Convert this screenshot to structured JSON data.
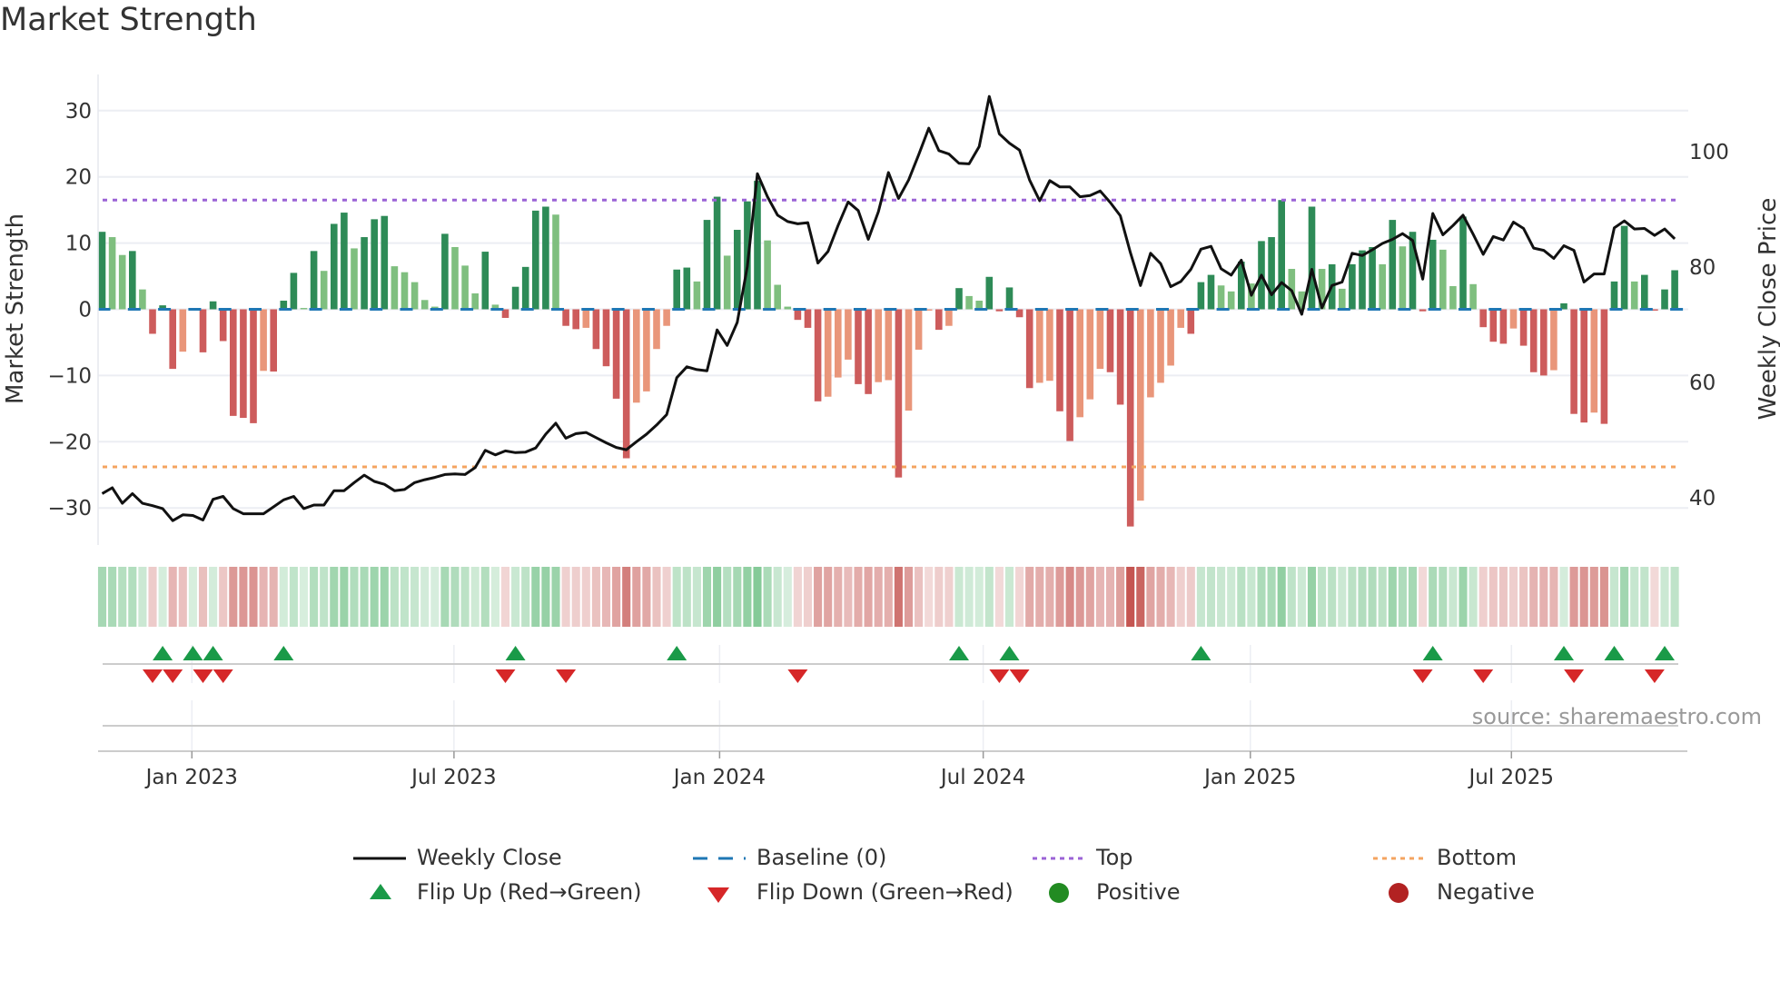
{
  "title": "Market Strength",
  "source": "source: sharemaestro.com",
  "legend": {
    "weekly_close": "Weekly Close",
    "baseline": "Baseline (0)",
    "top": "Top",
    "bottom": "Bottom",
    "flip_up": "Flip Up (Red→Green)",
    "flip_down": "Flip Down (Green→Red)",
    "positive": "Positive",
    "negative": "Negative"
  },
  "colors": {
    "bar_pos_rising": "#2e8b57",
    "bar_pos_falling": "#7fbf7f",
    "bar_neg_falling": "#cd5c5c",
    "bar_neg_rising": "#e9967a",
    "line": "#111111",
    "baseline": "#1f77b4",
    "top": "#9b63d6",
    "bottom": "#f4a460",
    "flip_up": "#1a9a48",
    "flip_down": "#d62728",
    "positive": "#228b22",
    "negative": "#b22222"
  },
  "chart_data": {
    "type": "bar+line",
    "title": "Market Strength",
    "ylabel": "Market Strength",
    "y2label": "Weekly Close Price",
    "ylim": [
      -35,
      35
    ],
    "y2lim": [
      34,
      113
    ],
    "yticks": [
      "30",
      "20",
      "10",
      "0",
      "−10",
      "−20",
      "−30"
    ],
    "ytick_values": [
      30,
      20,
      10,
      0,
      -10,
      -20,
      -30
    ],
    "y2ticks": [
      "100",
      "80",
      "60",
      "40"
    ],
    "y2tick_values": [
      100,
      80,
      60,
      40
    ],
    "top_level": 16.5,
    "bottom_level": -23.8,
    "xticks": [
      {
        "label": "Jan 2023",
        "week": 9.9
      },
      {
        "label": "Jul 2023",
        "week": 35.9
      },
      {
        "label": "Jan 2024",
        "week": 62.25
      },
      {
        "label": "Jul 2024",
        "week": 88.4
      },
      {
        "label": "Jan 2025",
        "week": 114.9
      },
      {
        "label": "Jul 2025",
        "week": 140.8
      }
    ],
    "strength": [
      11.7,
      10.9,
      8.2,
      8.8,
      3.0,
      -3.7,
      0.6,
      -9.0,
      -6.4,
      0.2,
      -6.5,
      1.2,
      -4.8,
      -16.1,
      -16.4,
      -17.2,
      -9.3,
      -9.4,
      1.3,
      5.5,
      0.2,
      8.8,
      5.8,
      12.9,
      14.6,
      9.2,
      10.9,
      13.6,
      14.1,
      6.5,
      5.6,
      4.1,
      1.4,
      0.4,
      11.4,
      9.4,
      6.6,
      2.4,
      8.7,
      0.7,
      -1.3,
      3.4,
      6.4,
      14.9,
      15.5,
      14.3,
      -2.5,
      -3.0,
      -2.8,
      -6.0,
      -8.6,
      -13.5,
      -22.5,
      -14.1,
      -12.4,
      -6.0,
      -2.5,
      6.0,
      6.3,
      4.2,
      13.5,
      17.0,
      8.1,
      12.0,
      16.3,
      19.4,
      10.4,
      3.7,
      0.4,
      -1.6,
      -2.8,
      -13.9,
      -13.2,
      -10.3,
      -7.6,
      -11.3,
      -12.8,
      -11.0,
      -10.7,
      -25.4,
      -15.3,
      -6.1,
      -0.2,
      -3.1,
      -2.5,
      3.2,
      2.0,
      1.3,
      4.9,
      -0.3,
      3.3,
      -1.2,
      -11.9,
      -11.1,
      -10.8,
      -15.4,
      -19.9,
      -16.3,
      -13.6,
      -9.0,
      -9.5,
      -14.4,
      -32.8,
      -28.9,
      -13.3,
      -11.1,
      -8.5,
      -2.8,
      -3.7,
      4.1,
      5.2,
      3.6,
      2.7,
      7.2,
      3.9,
      10.3,
      10.9,
      16.5,
      6.1,
      2.7,
      15.5,
      6.1,
      6.8,
      3.1,
      6.8,
      8.9,
      9.4,
      6.8,
      13.5,
      9.5,
      11.7,
      -0.3,
      10.5,
      9.0,
      3.5,
      14.0,
      3.8,
      -2.7,
      -4.9,
      -5.2,
      -2.9,
      -5.5,
      -9.5,
      -10.0,
      -9.2,
      0.9,
      -15.8,
      -17.1,
      -15.6,
      -17.3,
      4.2,
      12.6,
      4.2,
      5.2,
      -0.2,
      3.0,
      5.9
    ],
    "weekly_close": [
      40.7,
      41.7,
      39.0,
      40.7,
      39.0,
      38.6,
      38.1,
      36.0,
      37.0,
      36.9,
      36.1,
      39.7,
      40.2,
      38.1,
      37.2,
      37.2,
      37.2,
      38.4,
      39.6,
      40.2,
      38.1,
      38.7,
      38.7,
      41.2,
      41.2,
      42.6,
      43.9,
      42.8,
      42.3,
      41.2,
      41.4,
      42.6,
      43.1,
      43.5,
      44.0,
      44.1,
      44.0,
      45.2,
      48.2,
      47.4,
      48.1,
      47.8,
      47.9,
      48.6,
      51.0,
      52.9,
      50.3,
      51.1,
      51.3,
      50.4,
      49.5,
      48.7,
      48.3,
      49.7,
      51.0,
      52.6,
      54.4,
      60.8,
      62.7,
      62.2,
      62.0,
      69.1,
      66.4,
      70.4,
      80.1,
      96.2,
      92.2,
      89.0,
      87.9,
      87.5,
      87.7,
      80.7,
      82.7,
      87.2,
      91.3,
      89.8,
      84.8,
      89.6,
      96.4,
      91.9,
      95.1,
      99.5,
      104.1,
      100.2,
      99.6,
      98.0,
      97.9,
      100.9,
      109.6,
      103.1,
      101.5,
      100.3,
      95.1,
      91.5,
      95.0,
      93.9,
      93.9,
      92.2,
      92.4,
      93.2,
      91.2,
      88.9,
      82.5,
      76.8,
      82.4,
      80.6,
      76.6,
      77.5,
      79.6,
      83.1,
      83.6,
      79.7,
      78.6,
      81.2,
      75.1,
      78.6,
      75.2,
      77.3,
      75.9,
      71.8,
      79.6,
      72.9,
      76.8,
      77.4,
      82.4,
      82.0,
      83.0,
      84.1,
      84.8,
      85.8,
      84.6,
      77.9,
      89.3,
      85.6,
      87.2,
      89.0,
      85.7,
      82.2,
      85.3,
      84.7,
      87.8,
      86.7,
      83.3,
      82.9,
      81.5,
      83.7,
      82.9,
      77.4,
      78.8,
      78.8,
      86.8,
      88.0,
      86.6,
      86.7,
      85.5,
      86.6,
      84.9
    ],
    "flip_up_weeks": [
      7,
      10,
      12,
      19,
      42,
      58,
      86,
      91,
      110,
      133,
      146,
      151,
      156
    ],
    "flip_down_weeks": [
      6,
      8,
      11,
      13,
      41,
      47,
      70,
      90,
      92,
      132,
      138,
      147,
      155
    ],
    "legend_position": "bottom"
  }
}
